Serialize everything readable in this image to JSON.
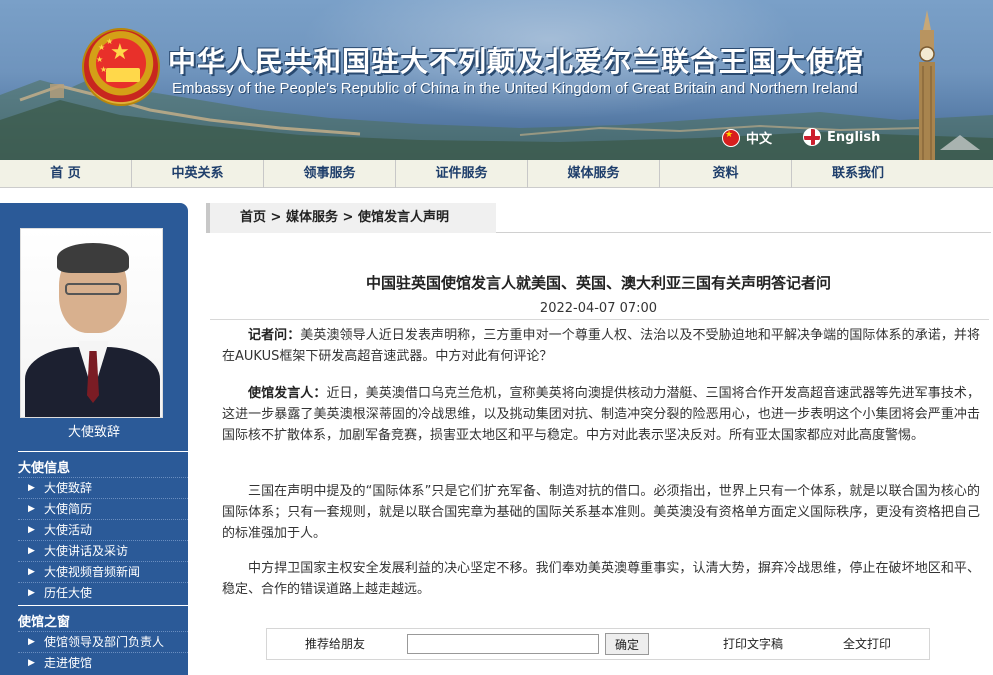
{
  "header": {
    "title_cn": "中华人民共和国驻大不列颠及北爱尔兰联合王国大使馆",
    "title_en": "Embassy of the People's Republic of China in the United Kingdom of Great Britain and Northern Ireland",
    "languages": [
      {
        "label": "中文",
        "icon": "china-flag-icon"
      },
      {
        "label": "English",
        "icon": "uk-flag-icon"
      }
    ]
  },
  "nav": {
    "items": [
      "首 页",
      "中英关系",
      "领事服务",
      "证件服务",
      "媒体服务",
      "资料",
      "联系我们"
    ]
  },
  "sidebar": {
    "photo_caption": "大使致辞",
    "section1_title": "大使信息",
    "section1_items": [
      "大使致辞",
      "大使简历",
      "大使活动",
      "大使讲话及采访",
      "大使视频音频新闻",
      "历任大使"
    ],
    "section2_title": "使馆之窗",
    "section2_items": [
      "使馆领导及部门负责人",
      "走进使馆"
    ]
  },
  "breadcrumb": {
    "home": "首页",
    "sep": ">",
    "level1": "媒体服务",
    "level2": "使馆发言人声明"
  },
  "article": {
    "title": "中国驻英国使馆发言人就美国、英国、澳大利亚三国有关声明答记者问",
    "date": "2022-04-07 07:00",
    "q_label": "记者问：",
    "q_text": "美英澳领导人近日发表声明称，三方重申对一个尊重人权、法治以及不受胁迫地和平解决争端的国际体系的承诺，并将在AUKUS框架下研发高超音速武器。中方对此有何评论？",
    "a_label": "使馆发言人：",
    "a_text": "近日，美英澳借口乌克兰危机，宣称美英将向澳提供核动力潜艇、三国将合作开发高超音速武器等先进军事技术，这进一步暴露了美英澳根深蒂固的冷战思维，以及挑动集团对抗、制造冲突分裂的险恶用心，也进一步表明这个小集团将会严重冲击国际核不扩散体系，加剧军备竞赛，损害亚太地区和平与稳定。中方对此表示坚决反对。所有亚太国家都应对此高度警惕。",
    "p3": "三国在声明中提及的“国际体系”只是它们扩充军备、制造对抗的借口。必须指出，世界上只有一个体系，就是以联合国为核心的国际体系；只有一套规则，就是以联合国宪章为基础的国际关系基本准则。美英澳没有资格单方面定义国际秩序，更没有资格把自己的标准强加于人。",
    "p4": "中方捍卫国家主权安全发展利益的决心坚定不移。我们奉劝美英澳尊重事实，认清大势，摒弃冷战思维，停止在破坏地区和平、稳定、合作的错误道路上越走越远。"
  },
  "tools": {
    "recommend_label": "推荐给朋友",
    "input_value": "",
    "confirm_label": "确定",
    "print_label": "打印文字稿",
    "full_print_label": "全文打印"
  }
}
